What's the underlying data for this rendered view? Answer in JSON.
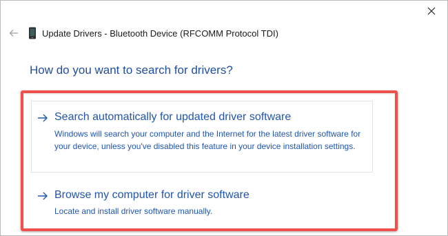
{
  "window": {
    "title": "Update Drivers - Bluetooth Device (RFCOMM Protocol TDI)",
    "back_icon": "back-arrow-icon",
    "device_icon": "device-icon",
    "close_icon": "close-icon"
  },
  "heading": "How do you want to search for drivers?",
  "options": [
    {
      "title": "Search automatically for updated driver software",
      "description": "Windows will search your computer and the Internet for the latest driver software for your device, unless you've disabled this feature in your device installation settings.",
      "icon": "right-arrow-icon"
    },
    {
      "title": "Browse my computer for driver software",
      "description": "Locate and install driver software manually.",
      "icon": "right-arrow-icon"
    }
  ],
  "colors": {
    "link_blue": "#1f55b0",
    "heading_blue": "#1f4e9e",
    "highlight_red": "#f0504a"
  }
}
